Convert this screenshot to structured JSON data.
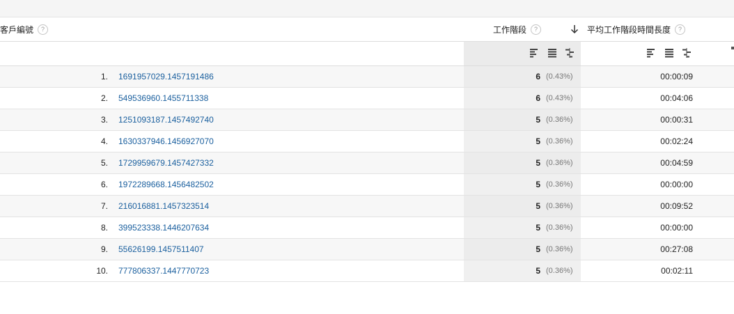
{
  "header": {
    "client_id_label": "客戶編號",
    "sessions_label": "工作階段",
    "avg_duration_label": "平均工作階段時間長度",
    "help_glyph": "?"
  },
  "rows": [
    {
      "index": "1.",
      "client_id": "1691957029.1457191486",
      "sessions": "6",
      "pct": "(0.43%)",
      "duration": "00:00:09"
    },
    {
      "index": "2.",
      "client_id": "549536960.1455711338",
      "sessions": "6",
      "pct": "(0.43%)",
      "duration": "00:04:06"
    },
    {
      "index": "3.",
      "client_id": "1251093187.1457492740",
      "sessions": "5",
      "pct": "(0.36%)",
      "duration": "00:00:31"
    },
    {
      "index": "4.",
      "client_id": "1630337946.1456927070",
      "sessions": "5",
      "pct": "(0.36%)",
      "duration": "00:02:24"
    },
    {
      "index": "5.",
      "client_id": "1729959679.1457427332",
      "sessions": "5",
      "pct": "(0.36%)",
      "duration": "00:04:59"
    },
    {
      "index": "6.",
      "client_id": "1972289668.1456482502",
      "sessions": "5",
      "pct": "(0.36%)",
      "duration": "00:00:00"
    },
    {
      "index": "7.",
      "client_id": "216016881.1457323514",
      "sessions": "5",
      "pct": "(0.36%)",
      "duration": "00:09:52"
    },
    {
      "index": "8.",
      "client_id": "399523338.1446207634",
      "sessions": "5",
      "pct": "(0.36%)",
      "duration": "00:00:00"
    },
    {
      "index": "9.",
      "client_id": "55626199.1457511407",
      "sessions": "5",
      "pct": "(0.36%)",
      "duration": "00:27:08"
    },
    {
      "index": "10.",
      "client_id": "777806337.1447770723",
      "sessions": "5",
      "pct": "(0.36%)",
      "duration": "00:02:11"
    }
  ],
  "icons": {
    "sort": "sort-down-arrow-icon",
    "view_controls": [
      "bar-chart-view-icon",
      "table-view-icon",
      "comparison-view-icon"
    ]
  },
  "colors": {
    "link": "#1a5f9e",
    "shaded_column": "#ececec",
    "row_alt": "#f7f7f7"
  }
}
